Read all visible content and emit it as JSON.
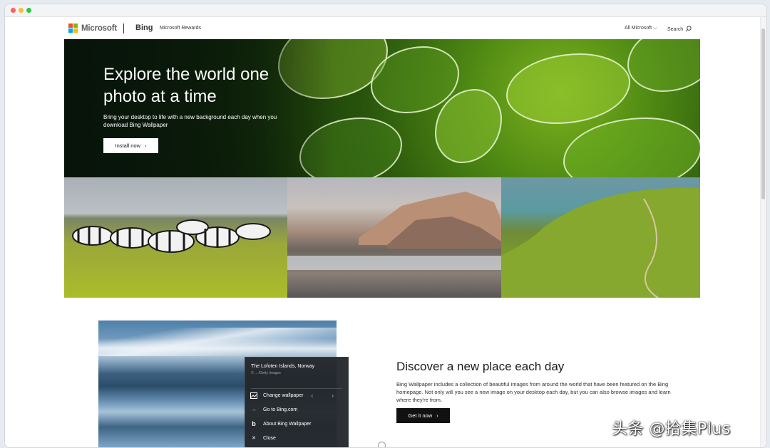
{
  "nav": {
    "logo_text": "Microsoft",
    "logo_colors": [
      "#f25022",
      "#7fba00",
      "#00a4ef",
      "#ffb900"
    ],
    "bing": "Bing",
    "rewards": "Microsoft Rewards",
    "all_microsoft": "All Microsoft",
    "search": "Search"
  },
  "hero": {
    "title": "Explore the world one photo at a time",
    "subtitle": "Bring your desktop to life with a new background each day when you download Bing Wallpaper",
    "install_label": "Install now"
  },
  "feature": {
    "menu": {
      "location": "The Lofoten Islands, Norway",
      "credit": "© ... /Getty Images",
      "items": [
        {
          "label": "Change wallpaper",
          "icon": "image-icon"
        },
        {
          "label": "Go to Bing.com",
          "icon": "arrow-right-icon"
        },
        {
          "label": "About Bing Wallpaper",
          "icon": "bing-icon"
        },
        {
          "label": "Close",
          "icon": "close-icon"
        }
      ]
    },
    "title": "Discover a new place each day",
    "body": "Bing Wallpaper includes a collection of beautiful images from around the world that have been featured on the Bing homepage. Not only will you see a new image on your desktop each day, but you can also browse images and learn where they're from.",
    "cta_label": "Get it now"
  },
  "watermark": "头条 @拾集Plus"
}
